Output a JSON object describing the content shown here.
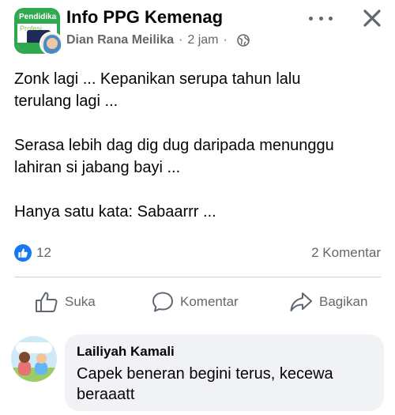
{
  "post": {
    "group_name": "Info PPG Kemenag",
    "group_avatar_text1": "Pendidikan",
    "group_avatar_text2": "Profesi",
    "author": "Dian Rana Meilika",
    "separator": "·",
    "time": "2 jam",
    "privacy_icon": "globe-icon",
    "body_lines": [
      "Zonk lagi ... Kepanikan serupa tahun lalu",
      "terulang lagi ...",
      "",
      "Serasa lebih dag dig dug daripada menunggu",
      "lahiran si jabang bayi ...",
      "",
      "Hanya satu kata: Sabaarrr ..."
    ]
  },
  "stats": {
    "reaction_icon": "like-icon",
    "reaction_count": "12",
    "comments_label": "2 Komentar"
  },
  "actions": {
    "like_label": "Suka",
    "comment_label": "Komentar",
    "share_label": "Bagikan"
  },
  "comment": {
    "name": "Lailiyah Kamali",
    "text": "Capek beneran begini terus, kecewa beraaatt"
  },
  "colors": {
    "brand_blue": "#1877f2",
    "secondary_text": "#65676b",
    "bubble_bg": "#f0f2f5",
    "group_green": "#2fa84f"
  }
}
